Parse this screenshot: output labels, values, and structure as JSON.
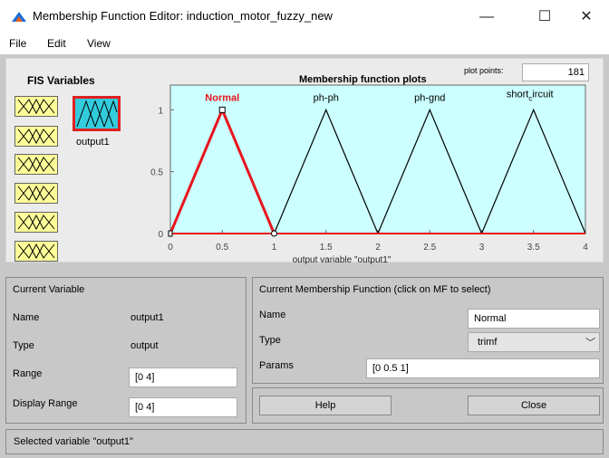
{
  "window": {
    "title": "Membership Function Editor: induction_motor_fuzzy_new",
    "minimize": "—",
    "maximize": "☐",
    "close": "✕"
  },
  "menu": [
    "File",
    "Edit",
    "View"
  ],
  "fis": {
    "label": "FIS Variables",
    "output_label": "output1"
  },
  "plot": {
    "title": "Membership function plots",
    "plot_points_label": "plot points:",
    "plot_points_value": "181"
  },
  "chart_data": {
    "type": "line",
    "xlabel": "output variable \"output1\"",
    "xlim": [
      0,
      4
    ],
    "ylim": [
      0,
      1.2
    ],
    "xticks": [
      "0",
      "0.5",
      "1",
      "1.5",
      "2",
      "2.5",
      "3",
      "3.5",
      "4"
    ],
    "yticks": [
      "0",
      "0.5",
      "1"
    ],
    "series": [
      {
        "name": "Normal",
        "x": [
          0,
          0.5,
          1
        ],
        "y": [
          0,
          1,
          0
        ],
        "color": "#e8141c",
        "selected": true
      },
      {
        "name": "ph-ph",
        "x": [
          1,
          1.5,
          2
        ],
        "y": [
          0,
          1,
          0
        ],
        "color": "#000000",
        "selected": false
      },
      {
        "name": "ph-gnd",
        "x": [
          2,
          2.5,
          3
        ],
        "y": [
          0,
          1,
          0
        ],
        "color": "#000000",
        "selected": false
      },
      {
        "name": "short_circuit",
        "x": [
          3,
          3.5,
          4
        ],
        "y": [
          0,
          1,
          0
        ],
        "color": "#000000",
        "selected": false
      }
    ],
    "background": "#ccffff"
  },
  "current_variable": {
    "header": "Current Variable",
    "name_label": "Name",
    "name_value": "output1",
    "type_label": "Type",
    "type_value": "output",
    "range_label": "Range",
    "range_value": "[0 4]",
    "display_range_label": "Display Range",
    "display_range_value": "[0 4]"
  },
  "current_mf": {
    "header": "Current Membership Function (click on MF to select)",
    "name_label": "Name",
    "name_value": "Normal",
    "type_label": "Type",
    "type_value": "trimf",
    "params_label": "Params",
    "params_value": "[0 0.5 1]"
  },
  "buttons": {
    "help": "Help",
    "close": "Close"
  },
  "status": "Selected variable \"output1\""
}
